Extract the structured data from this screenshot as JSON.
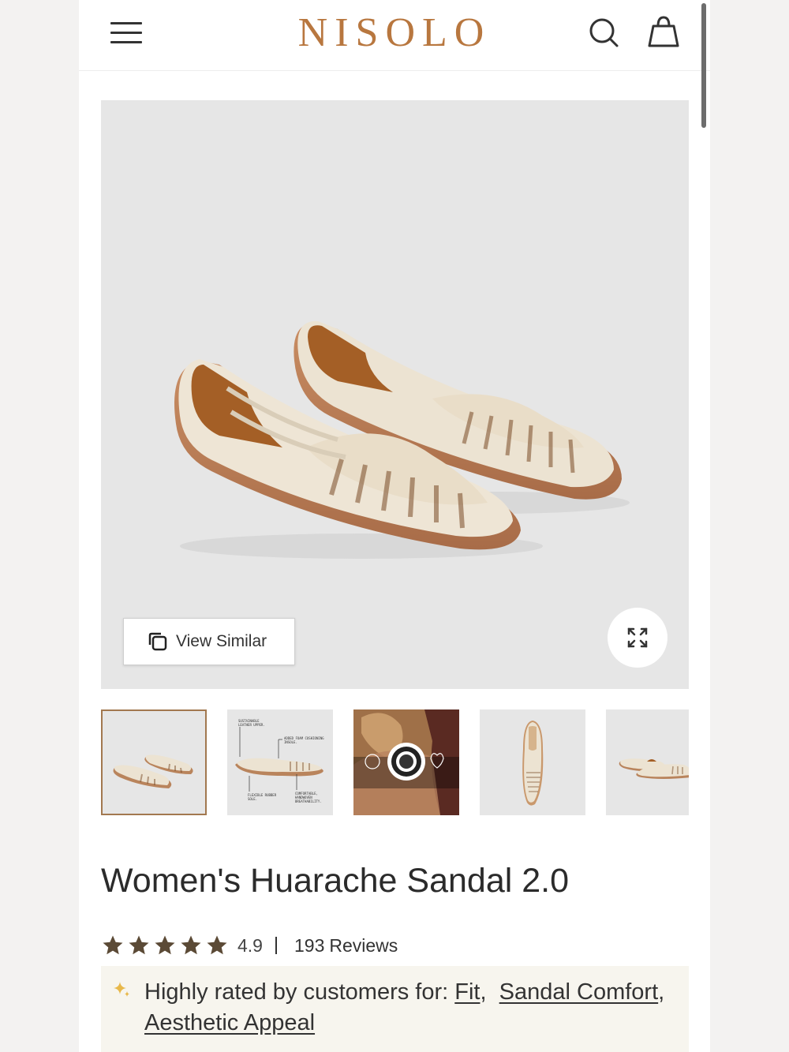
{
  "header": {
    "brand": "NISOLO",
    "menu_icon": "hamburger-menu-icon",
    "search_icon": "search-icon",
    "bag_icon": "shopping-bag-icon"
  },
  "gallery": {
    "view_similar_label": "View Similar",
    "thumbnails": [
      {
        "name": "angled-pair",
        "selected": true
      },
      {
        "name": "feature-callouts",
        "selected": false,
        "callouts": [
          "SUSTAINABLE LEATHER UPPER.",
          "ADDED FOAM CUSHIONING INSOLE.",
          "FLEXIBLE RUBBER SOLE.",
          "COMFORTABLE, HANDWOVEN BREATHABILITY."
        ]
      },
      {
        "name": "leather-working-group-certification",
        "selected": false
      },
      {
        "name": "top-view",
        "selected": false
      },
      {
        "name": "side-view-pair",
        "selected": false
      }
    ]
  },
  "product": {
    "title": "Women's Huarache Sandal 2.0",
    "rating": "4.9",
    "stars_filled": 5,
    "review_count": "193",
    "review_label": "Reviews"
  },
  "highlights": {
    "prefix": "Highly rated by customers for:",
    "items": [
      "Fit",
      "Sandal Comfort",
      "Aesthetic Appeal"
    ]
  },
  "colors": {
    "brand": "#b8773f",
    "selected_thumb_border": "#a2784f",
    "star": "#5b4a36",
    "sparkle": "#e8b84a",
    "highlight_bg": "#f7f5ee"
  }
}
